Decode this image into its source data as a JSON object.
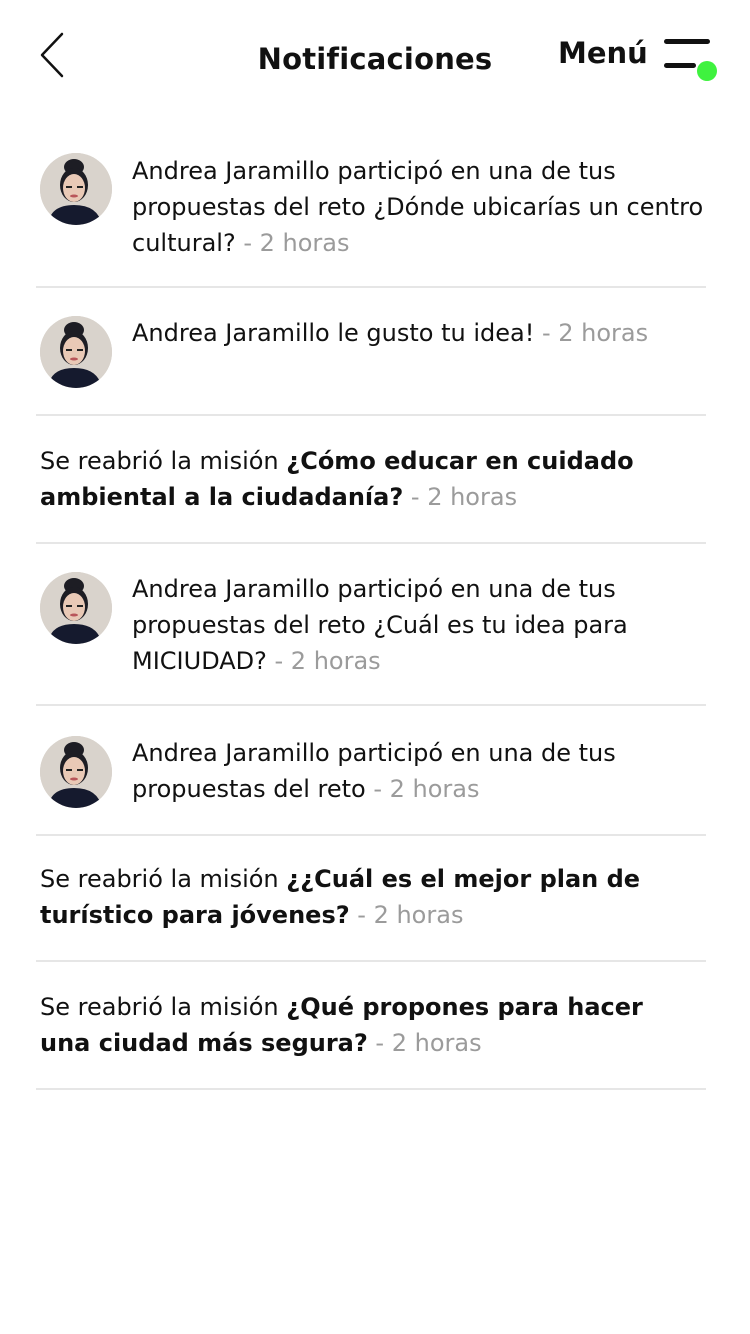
{
  "header": {
    "title": "Notificaciones",
    "menu_label": "Menú",
    "menu_dot_color": "#3ff23f",
    "back_icon": "chevron-left-icon"
  },
  "notifications": [
    {
      "type": "user",
      "text": "Andrea Jaramillo participó en una de tus propuestas del reto ¿Dónde ubicarías un centro cultural?",
      "time": " - 2 horas"
    },
    {
      "type": "user",
      "text": "Andrea Jaramillo le gusto tu idea!",
      "time": " - 2 horas"
    },
    {
      "type": "mission",
      "prefix": "Se reabrió la misión ",
      "title": "¿Cómo educar en cuidado ambiental a la ciudadanía?",
      "time": " - 2 horas"
    },
    {
      "type": "user",
      "text": "Andrea Jaramillo participó en una de tus propuestas del reto ¿Cuál es tu idea para MICIUDAD?",
      "time": " - 2 horas"
    },
    {
      "type": "user",
      "text": "Andrea Jaramillo participó en una de tus propuestas del reto",
      "time": " - 2 horas"
    },
    {
      "type": "mission",
      "prefix": "Se reabrió la misión ",
      "title": "¿¿Cuál es el mejor plan de turístico para jóvenes?",
      "time": " - 2 horas"
    },
    {
      "type": "mission",
      "prefix": "Se reabrió la misión ",
      "title": "¿Qué propones para hacer una ciudad más segura?",
      "time": " - 2 horas"
    }
  ]
}
